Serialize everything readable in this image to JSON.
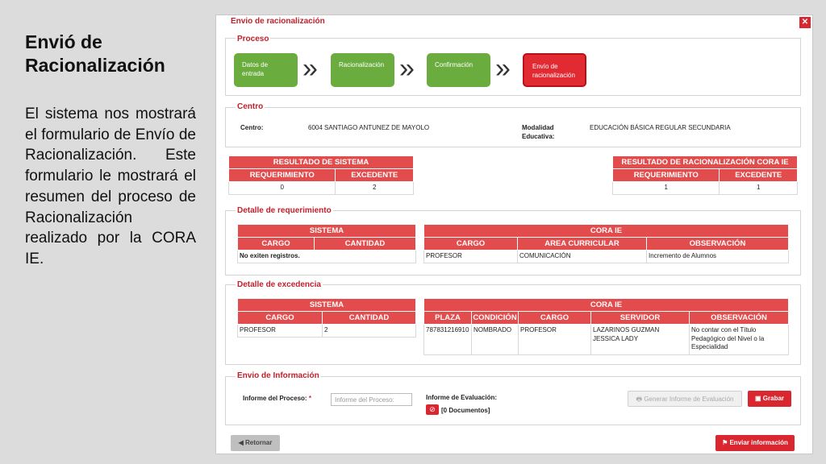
{
  "slide": {
    "title": "Envió de Racionalización",
    "body": "El sistema nos mostrará el formulario de Envío de Racionalización. Este formulario le mostrará el resumen del proceso de Racionalización realizado por la CORA IE."
  },
  "window": {
    "title": "Envio de racionalización",
    "close": "✕"
  },
  "proceso": {
    "title": "Proceso",
    "steps": [
      "Datos de entrada",
      "Racionalización",
      "Confirmación",
      "Envío de racionalización"
    ],
    "chevron": "»"
  },
  "centro": {
    "title": "Centro",
    "label": "Centro:",
    "value": "6004 SANTIAGO ANTUNEZ DE MAYOLO",
    "mod_label": "Modalidad Educativa:",
    "mod_value": "EDUCACIÓN BÁSICA REGULAR SECUNDARIA"
  },
  "res_sistema": {
    "title": "RESULTADO DE SISTEMA",
    "h1": "REQUERIMIENTO",
    "h2": "EXCEDENTE",
    "v1": "0",
    "v2": "2"
  },
  "res_cora": {
    "title": "RESULTADO DE RACIONALIZACIÓN CORA IE",
    "h1": "REQUERIMIENTO",
    "h2": "EXCEDENTE",
    "v1": "1",
    "v2": "1"
  },
  "det_req": {
    "title": "Detalle de requerimiento",
    "sistema": "SISTEMA",
    "cargo": "CARGO",
    "cantidad": "CANTIDAD",
    "empty": "No exiten registros.",
    "cora": "CORA IE",
    "area": "AREA CURRICULAR",
    "obs": "OBSERVACIÓN",
    "row": {
      "cargo": "PROFESOR",
      "area": "COMUNICACIÓN",
      "obs": "Incremento de Alumnos"
    }
  },
  "det_exc": {
    "title": "Detalle de excedencia",
    "sistema": "SISTEMA",
    "cargo": "CARGO",
    "cantidad": "CANTIDAD",
    "srow": {
      "cargo": "PROFESOR",
      "cantidad": "2"
    },
    "cora": "CORA IE",
    "plaza": "PLAZA",
    "condicion": "CONDICIÓN",
    "servidor": "SERVIDOR",
    "obs": "OBSERVACIÓN",
    "row": {
      "plaza": "787831216910",
      "condicion": "NOMBRADO",
      "cargo": "PROFESOR",
      "servidor": "LAZARINOS GUZMAN JESSICA LADY",
      "obs": "No contar con el Título Pedagógico del Nivel o la Especialidad"
    }
  },
  "envio": {
    "title": "Envio de Información",
    "informe_label": "Informe del Proceso:",
    "required": "*",
    "informe_placeholder": "Informe del Proceso:",
    "eval_label": "Informe de Evaluación:",
    "docs": "[0 Documentos]",
    "generar": "Generar Informe de Evaluación",
    "grabar": "Grabar"
  },
  "footer": {
    "retornar": "Retornar",
    "enviar": "Enviar información"
  }
}
